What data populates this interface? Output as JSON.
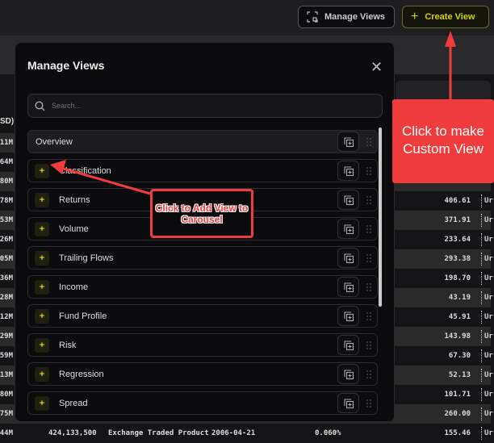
{
  "toolbar": {
    "manage_views": "Manage Views",
    "create_view": "Create View"
  },
  "table": {
    "header_fragment": "SD)",
    "left_values": [
      "11M",
      "64M",
      "80M",
      "78M",
      "53M",
      "26M",
      "05M",
      "36M",
      "28M",
      "12M",
      "29M",
      "59M",
      "13M",
      "80M",
      "75M",
      "44M"
    ],
    "right_values": [
      "",
      "",
      "",
      "406.61",
      "371.91",
      "233.64",
      "293.38",
      "198.70",
      "43.19",
      "45.91",
      "143.98",
      "67.30",
      "52.13",
      "101.71",
      "260.00",
      "155.46"
    ],
    "unit_fragment": "Ur",
    "last_row": {
      "shares": "424,133,500",
      "type": "Exchange Traded Product",
      "date": "2006-04-21",
      "pct": "0.060%"
    }
  },
  "modal": {
    "title": "Manage Views",
    "search_placeholder": "Search...",
    "items": [
      "Overview",
      "Classification",
      "Returns",
      "Volume",
      "Trailing Flows",
      "Income",
      "Fund Profile",
      "Risk",
      "Regression",
      "Spread"
    ]
  },
  "annotations": {
    "create": "Click to make Custom View",
    "add": "Click to Add View to Carousel"
  },
  "colors": {
    "accent": "#d4d400",
    "annotation": "#f03c3c"
  }
}
